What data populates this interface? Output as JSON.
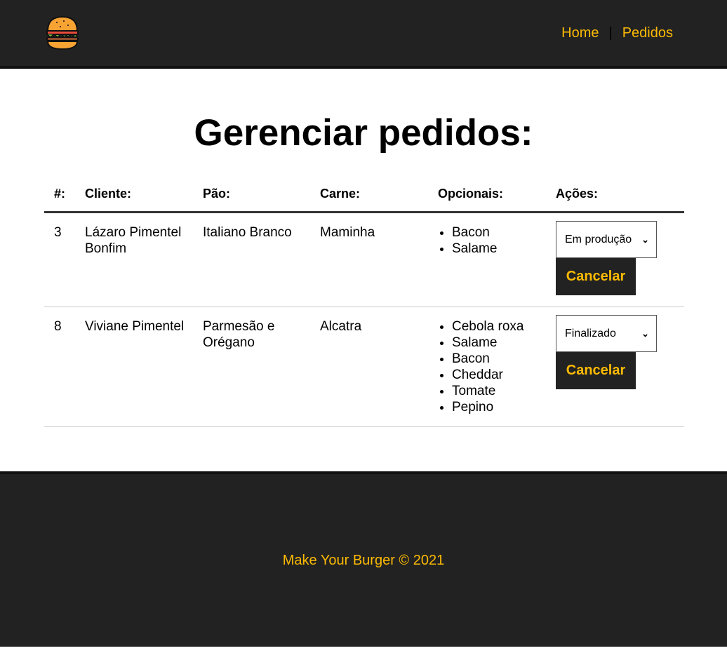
{
  "header": {
    "logo_icon": "burger-icon",
    "nav": [
      {
        "label": "Home"
      },
      {
        "label": "Pedidos"
      }
    ],
    "separator": "|"
  },
  "main": {
    "title": "Gerenciar pedidos:",
    "table": {
      "headers": {
        "id": "#:",
        "cliente": "Cliente:",
        "pao": "Pão:",
        "carne": "Carne:",
        "opcionais": "Opcionais:",
        "acoes": "Ações:"
      },
      "rows": [
        {
          "id": "3",
          "cliente": "Lázaro Pimentel Bonfim",
          "pao": "Italiano Branco",
          "carne": "Maminha",
          "opcionais": [
            "Bacon",
            "Salame"
          ],
          "status": "Em produção",
          "cancel_label": "Cancelar"
        },
        {
          "id": "8",
          "cliente": "Viviane Pimentel",
          "pao": "Parmesão e Orégano",
          "carne": "Alcatra",
          "opcionais": [
            "Cebola roxa",
            "Salame",
            "Bacon",
            "Cheddar",
            "Tomate",
            "Pepino"
          ],
          "status": "Finalizado",
          "cancel_label": "Cancelar"
        }
      ]
    }
  },
  "footer": {
    "text": "Make Your Burger © 2021"
  },
  "colors": {
    "dark": "#222222",
    "accent": "#fcba03"
  }
}
